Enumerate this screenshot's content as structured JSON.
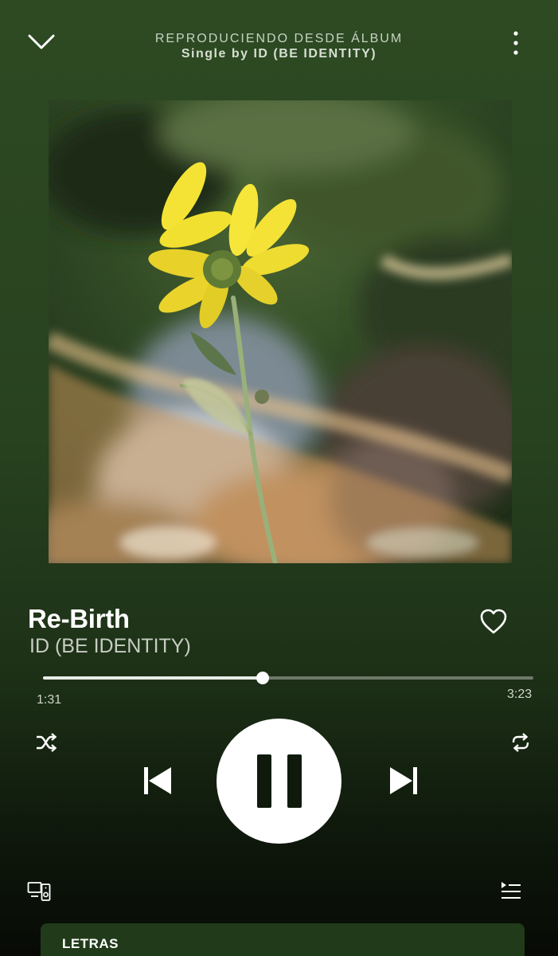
{
  "header": {
    "context_label": "REPRODUCIENDO DESDE ÁLBUM",
    "context_name": "Single by ID (BE IDENTITY)",
    "collapse_icon": "chevron-down-icon",
    "more_icon": "more-vertical-icon"
  },
  "artwork": {
    "icon": "album-art-yellow-flower"
  },
  "track": {
    "title": "Re-Birth",
    "artist": "ID (BE IDENTITY)",
    "liked_icon": "heart-outline-icon"
  },
  "progress": {
    "elapsed": "1:31",
    "total": "3:23",
    "fraction": 0.4483
  },
  "controls": {
    "shuffle_icon": "shuffle-icon",
    "previous_icon": "skip-previous-icon",
    "play_state_icon": "pause-icon",
    "next_icon": "skip-next-icon",
    "repeat_icon": "repeat-icon"
  },
  "footer": {
    "devices_icon": "devices-icon",
    "queue_icon": "queue-icon",
    "lyrics_label": "LETRAS"
  },
  "colors": {
    "background_top": "#2d4a23",
    "background_bottom": "#070a05",
    "lyrics_card": "#213b1a",
    "accent_white": "#ffffff"
  }
}
